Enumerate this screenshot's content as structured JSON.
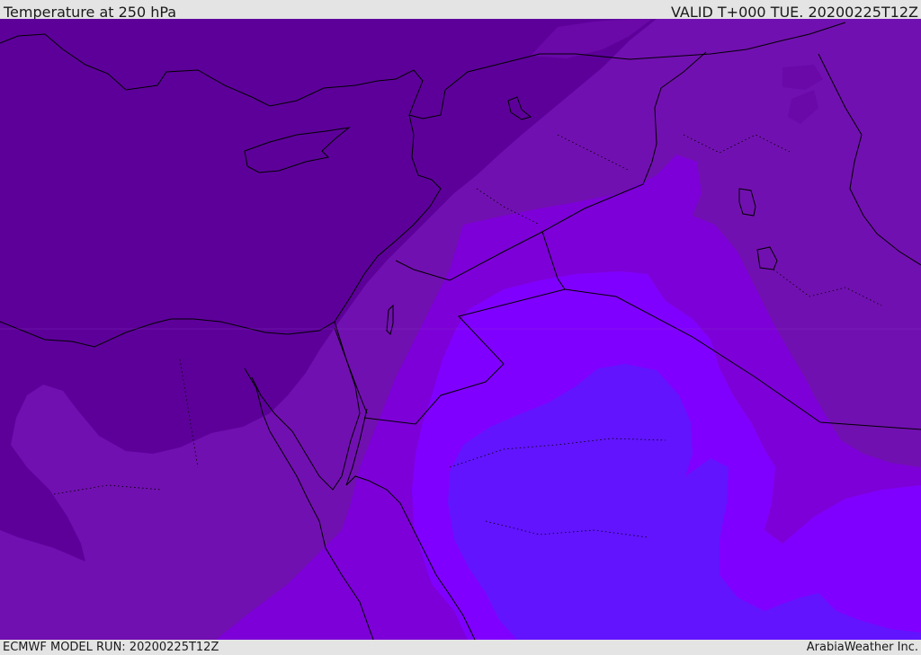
{
  "header": {
    "title": "Temperature at 250 hPa",
    "valid_time": "VALID T+000 TUE. 20200225T12Z"
  },
  "footer": {
    "model_run": "ECMWF MODEL RUN: 20200225T12Z",
    "credit": "ArabiaWeather Inc."
  },
  "map": {
    "variable": "Temperature",
    "level": "250 hPa",
    "region": "Eastern Mediterranean / Middle East",
    "colors": {
      "band_coldest": "#5d009a",
      "band_cold": "#7110b0",
      "band_mid": "#7d00d8",
      "band_warm": "#8000ff",
      "band_warmest": "#6214ff",
      "coastline": "#000000",
      "border": "#000000"
    }
  }
}
